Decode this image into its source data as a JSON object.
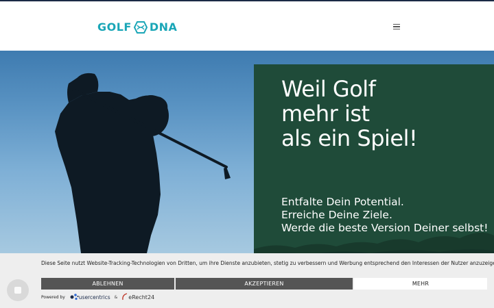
{
  "header": {
    "logo_left": "GOLF",
    "logo_right": "DNA",
    "menu_icon": "hamburger-icon"
  },
  "hero": {
    "headline_lines": [
      "Weil Golf",
      "mehr ist",
      "als ein  Spiel!"
    ],
    "sub_lines": [
      "Entfalte Dein Potential.",
      "Erreiche Deine Ziele.",
      "Werde die beste Version Deiner selbst!"
    ],
    "panel_color": "#1f4b39"
  },
  "consent": {
    "text": "Diese Seite nutzt Website-Tracking-Technologien von Dritten, um ihre Dienste anzubieten, stetig zu verbessern und Werbung entsprechend den Interessen der Nutzer anzuzeigen.",
    "decline_label": "ABLEHNEN",
    "accept_label": "AKZEPTIEREN",
    "more_label": "MEHR",
    "powered_by": "Powered by",
    "usercentrics": "usercentrics",
    "amp": "&",
    "erecht": "eRecht24"
  },
  "colors": {
    "brand": "#1aa6b7",
    "panel": "#1f4b39",
    "button": "#555555"
  }
}
